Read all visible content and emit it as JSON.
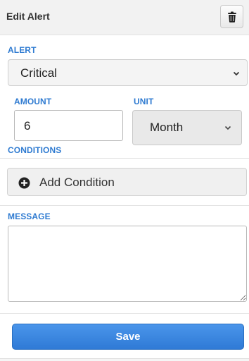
{
  "header": {
    "title": "Edit Alert",
    "delete_icon": "trash-icon"
  },
  "alert": {
    "label": "ALERT",
    "selected": "Critical"
  },
  "amount": {
    "label": "AMOUNT",
    "value": "6"
  },
  "unit": {
    "label": "UNIT",
    "selected": "Month"
  },
  "conditions": {
    "label": "CONDITIONS",
    "add_label": "Add Condition",
    "add_icon": "plus-circle-icon"
  },
  "message": {
    "label": "MESSAGE",
    "value": "",
    "resize_icon": "resize-handle-icon"
  },
  "footer": {
    "save_label": "Save"
  },
  "colors": {
    "label": "#2f7bd1",
    "save_button": "#3a86e0",
    "header_bg": "#f2f2f2"
  }
}
